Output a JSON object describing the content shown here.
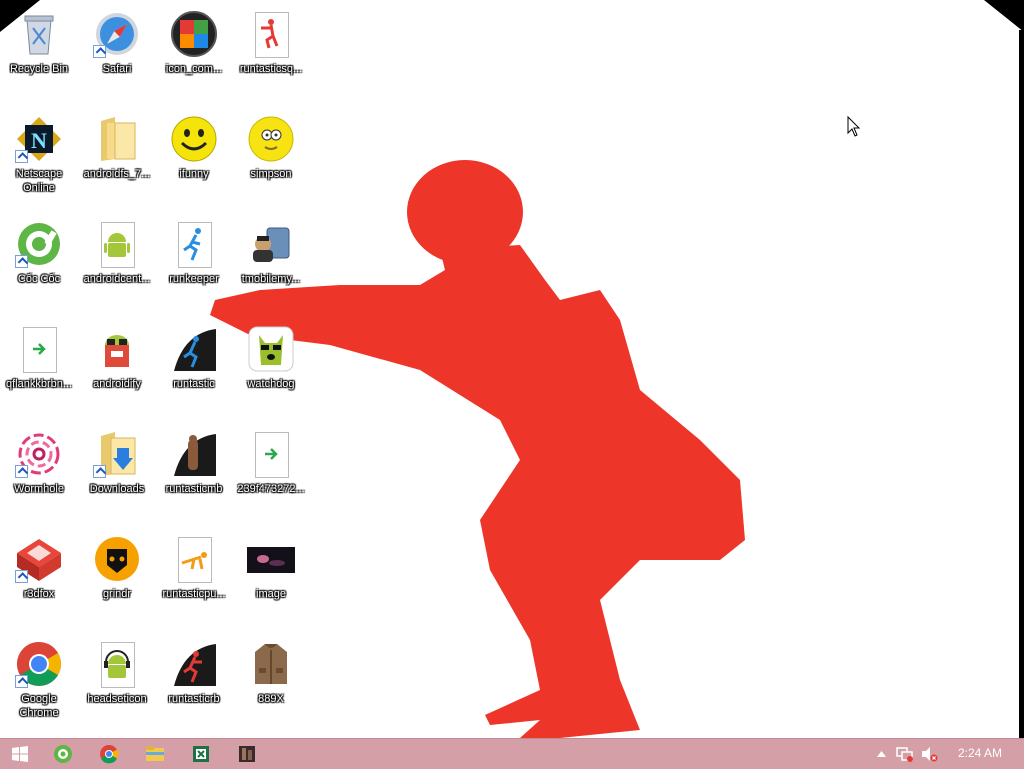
{
  "desktop": {
    "icons": [
      {
        "label": "Recycle Bin",
        "icon": "recycle-bin-icon"
      },
      {
        "label": "Safari",
        "icon": "safari-icon"
      },
      {
        "label": "icon_com...",
        "icon": "android-colorful-icon"
      },
      {
        "label": "runtasticsq...",
        "icon": "runtastic-squats-icon"
      },
      {
        "label": "Netscape Online",
        "icon": "netscape-icon"
      },
      {
        "label": "androidfs_7...",
        "icon": "folder-icon"
      },
      {
        "label": "ifunny",
        "icon": "smiley-icon"
      },
      {
        "label": "simpson",
        "icon": "simpson-icon"
      },
      {
        "label": "Cốc Cốc",
        "icon": "coccoc-icon"
      },
      {
        "label": "androidcent...",
        "icon": "android-icon"
      },
      {
        "label": "runkeeper",
        "icon": "runkeeper-icon"
      },
      {
        "label": "tmobilemy...",
        "icon": "tmobile-icon"
      },
      {
        "label": "qflankkbrbn...",
        "icon": "document-icon"
      },
      {
        "label": "androidify",
        "icon": "androidify-icon"
      },
      {
        "label": "runtastic",
        "icon": "runtastic-icon"
      },
      {
        "label": "watchdog",
        "icon": "watchdog-icon"
      },
      {
        "label": "Wormhole",
        "icon": "wormhole-icon"
      },
      {
        "label": "Downloads",
        "icon": "downloads-folder-icon"
      },
      {
        "label": "runtasticmb",
        "icon": "runtastic-mb-icon"
      },
      {
        "label": "239f473272...",
        "icon": "document-icon"
      },
      {
        "label": "r3dfox",
        "icon": "r3dfox-icon"
      },
      {
        "label": "grindr",
        "icon": "grindr-icon"
      },
      {
        "label": "runtasticpu...",
        "icon": "runtastic-pushups-icon"
      },
      {
        "label": "image",
        "icon": "image-icon"
      },
      {
        "label": "Google Chrome",
        "icon": "chrome-icon"
      },
      {
        "label": "headseticon",
        "icon": "android-headset-icon"
      },
      {
        "label": "runtasticrb",
        "icon": "runtastic-rb-icon"
      },
      {
        "label": "889X",
        "icon": "jacket-icon"
      }
    ]
  },
  "taskbar": {
    "items": [
      "start-icon",
      "coccoc-icon",
      "chrome-icon",
      "file-explorer-icon",
      "excel-icon",
      "app-icon"
    ],
    "tray": [
      "show-hidden-icons-icon",
      "network-icon",
      "volume-muted-icon"
    ],
    "clock": "2:24 AM"
  },
  "colors": {
    "taskbar": "#d49fa6",
    "wallpaper_figure": "#ee3529",
    "desktop": "#ffffff"
  }
}
